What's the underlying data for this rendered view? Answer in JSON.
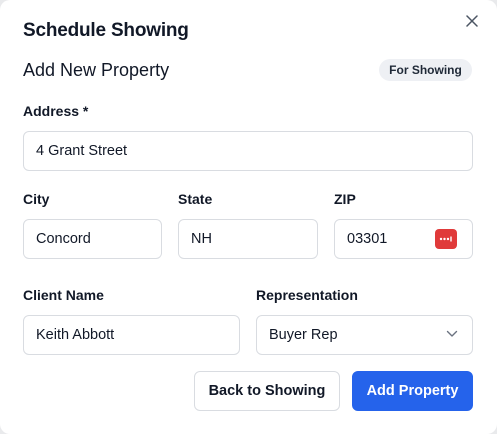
{
  "modal": {
    "title": "Schedule Showing",
    "close_icon": "close-icon"
  },
  "form": {
    "section_title": "Add New Property",
    "badge": "For Showing",
    "address": {
      "label": "Address *",
      "value": "4 Grant Street"
    },
    "city": {
      "label": "City",
      "value": "Concord"
    },
    "state": {
      "label": "State",
      "value": "NH"
    },
    "zip": {
      "label": "ZIP",
      "value": "03301",
      "icon": "password-manager-icon"
    },
    "client_name": {
      "label": "Client Name",
      "value": "Keith Abbott"
    },
    "representation": {
      "label": "Representation",
      "value": "Buyer Rep",
      "icon": "chevron-down-icon"
    }
  },
  "actions": {
    "back_label": "Back to Showing",
    "add_label": "Add Property"
  },
  "colors": {
    "primary": "#2563eb",
    "badge_bg": "#eef0f4",
    "password_icon": "#e03a3a"
  }
}
